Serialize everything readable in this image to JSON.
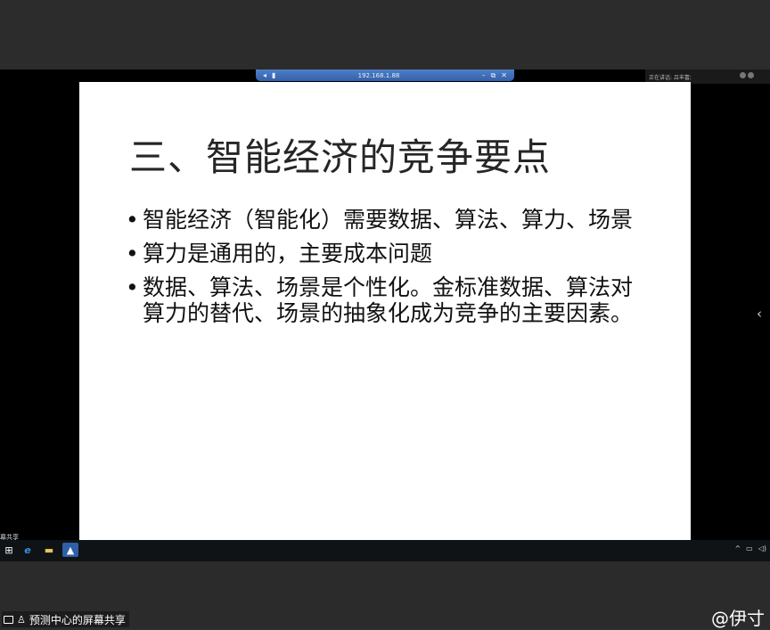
{
  "remote_toolbar": {
    "address": "192.168.1.88"
  },
  "speaking": {
    "label": "正在讲话: 吕丰富;"
  },
  "slide": {
    "title": "三、智能经济的竞争要点",
    "bullets": [
      "智能经济（智能化）需要数据、算法、算力、场景",
      "算力是通用的，主要成本问题",
      "数据、算法、场景是个性化。金标准数据、算法对算力的替代、场景的抽象化成为竞争的主要因素。"
    ],
    "bullet_symbol": "•"
  },
  "taskbar": {
    "left_text": "幕共享",
    "icons": [
      "windows-start-icon",
      "internet-explorer-icon",
      "file-explorer-icon",
      "remote-desktop-icon"
    ]
  },
  "bottom": {
    "share_label": "预测中心的屏幕共享",
    "account_tag": "@伊寸"
  }
}
